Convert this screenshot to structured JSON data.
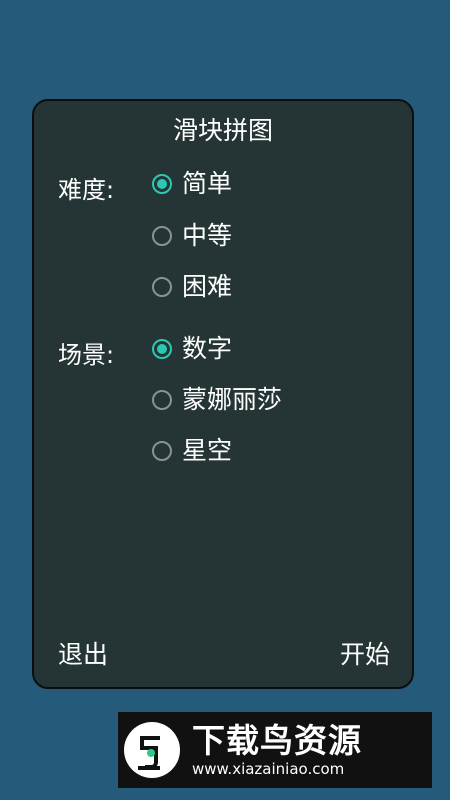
{
  "dialog": {
    "title": "滑块拼图",
    "difficulty": {
      "label": "难度:",
      "options": [
        {
          "label": "简单",
          "selected": true
        },
        {
          "label": "中等",
          "selected": false
        },
        {
          "label": "困难",
          "selected": false
        }
      ]
    },
    "scene": {
      "label": "场景:",
      "options": [
        {
          "label": "数字",
          "selected": true
        },
        {
          "label": "蒙娜丽莎",
          "selected": false
        },
        {
          "label": "星空",
          "selected": false
        }
      ]
    },
    "exit_label": "退出",
    "start_label": "开始"
  },
  "watermark": {
    "title": "下载鸟资源",
    "url": "www.xiazainiao.com"
  },
  "colors": {
    "background": "#265a7b",
    "dialog": "#253535",
    "accent": "#2bc9b1"
  }
}
